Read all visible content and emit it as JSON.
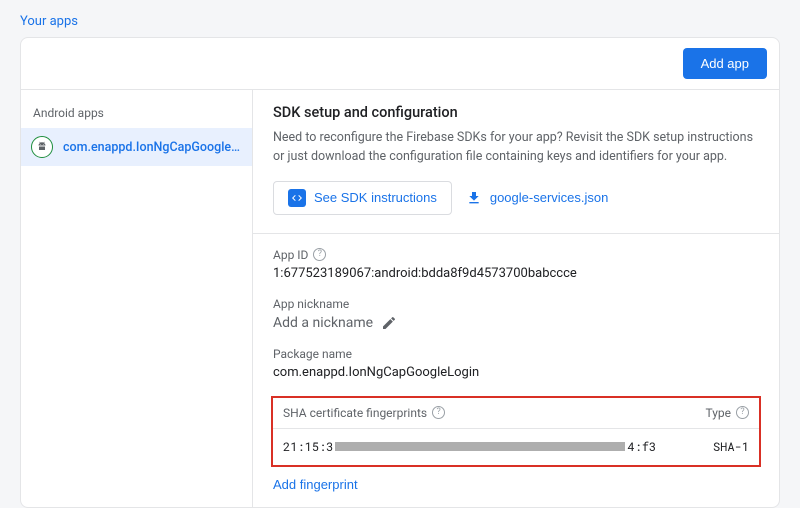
{
  "section_title": "Your apps",
  "header": {
    "add_app": "Add app"
  },
  "sidebar": {
    "label": "Android apps",
    "items": [
      {
        "name": "com.enappd.IonNgCapGoogleLogin"
      }
    ]
  },
  "main": {
    "title": "SDK setup and configuration",
    "desc": "Need to reconfigure the Firebase SDKs for your app? Revisit the SDK setup instructions or just download the configuration file containing keys and identifiers for your app.",
    "sdk_btn": "See SDK instructions",
    "download_btn": "google-services.json",
    "app_id_label": "App ID",
    "app_id": "1:677523189067:android:bdda8f9d4573700babccce",
    "nickname_label": "App nickname",
    "nickname_placeholder": "Add a nickname",
    "package_label": "Package name",
    "package": "com.enappd.IonNgCapGoogleLogin",
    "sha_label": "SHA certificate fingerprints",
    "type_label": "Type",
    "sha_prefix": "21:15:3",
    "sha_suffix": "4:f3",
    "sha_type": "SHA-1",
    "add_fp": "Add fingerprint"
  }
}
